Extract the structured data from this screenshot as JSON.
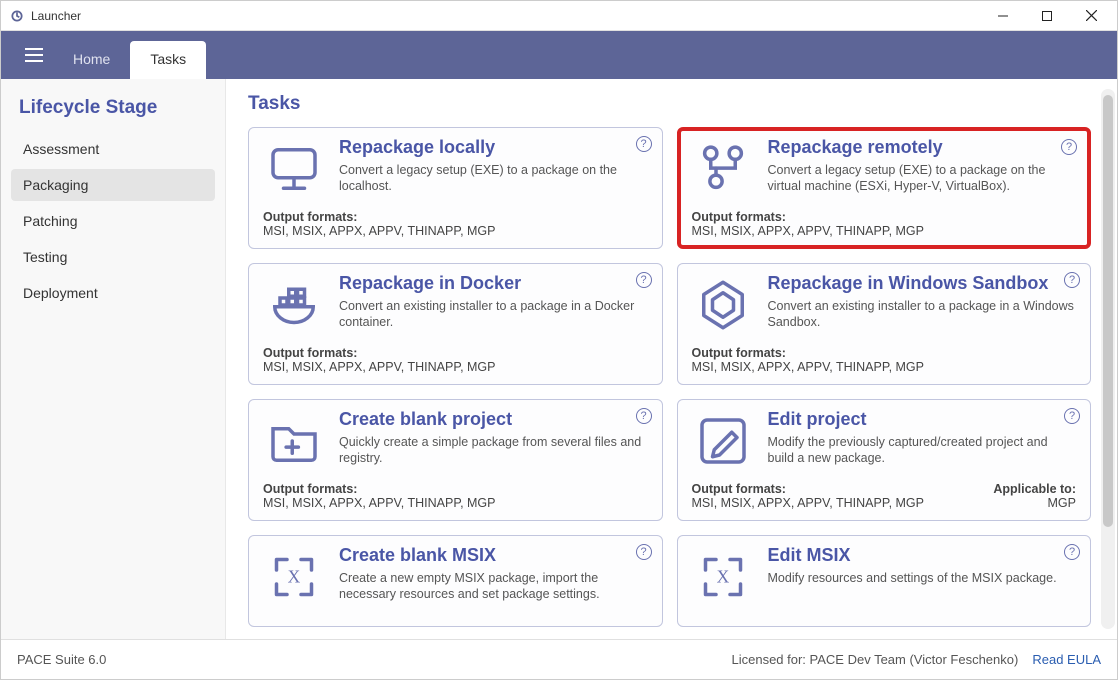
{
  "window": {
    "title": "Launcher"
  },
  "topnav": {
    "tabs": [
      {
        "label": "Home",
        "active": false
      },
      {
        "label": "Tasks",
        "active": true
      }
    ]
  },
  "sidebar": {
    "title": "Lifecycle Stage",
    "items": [
      {
        "label": "Assessment",
        "active": false
      },
      {
        "label": "Packaging",
        "active": true
      },
      {
        "label": "Patching",
        "active": false
      },
      {
        "label": "Testing",
        "active": false
      },
      {
        "label": "Deployment",
        "active": false
      }
    ]
  },
  "main": {
    "title": "Tasks",
    "output_label": "Output formats:",
    "applicable_label": "Applicable to:",
    "std_formats": "MSI, MSIX, APPX, APPV, THINAPP, MGP",
    "cards": [
      {
        "title": "Repackage locally",
        "desc": "Convert a legacy setup (EXE) to a package on the localhost.",
        "formats": "MSI, MSIX, APPX, APPV, THINAPP, MGP"
      },
      {
        "title": "Repackage remotely",
        "desc": "Convert a legacy setup (EXE) to a package on the virtual machine (ESXi, Hyper-V, VirtualBox).",
        "formats": "MSI, MSIX, APPX, APPV, THINAPP, MGP",
        "highlight": true
      },
      {
        "title": "Repackage in Docker",
        "desc": "Convert an existing installer to a package in a Docker container.",
        "formats": "MSI, MSIX, APPX, APPV, THINAPP, MGP"
      },
      {
        "title": "Repackage in Windows Sandbox",
        "desc": "Convert an existing installer to a package in a Windows Sandbox.",
        "formats": "MSI, MSIX, APPX, APPV, THINAPP, MGP"
      },
      {
        "title": "Create blank project",
        "desc": "Quickly create a simple package from several files and registry.",
        "formats": "MSI, MSIX, APPX, APPV, THINAPP, MGP"
      },
      {
        "title": "Edit project",
        "desc": "Modify the previously captured/created project and build a new package.",
        "formats": "MSI, MSIX, APPX, APPV, THINAPP, MGP",
        "applicable": "MGP"
      },
      {
        "title": "Create blank MSIX",
        "desc": "Create a new empty MSIX package, import the necessary resources and set package settings."
      },
      {
        "title": "Edit MSIX",
        "desc": "Modify resources and settings of the MSIX package."
      }
    ]
  },
  "footer": {
    "version": "PACE Suite 6.0",
    "license": "Licensed for: PACE Dev Team (Victor Feschenko)",
    "eula": "Read EULA"
  }
}
